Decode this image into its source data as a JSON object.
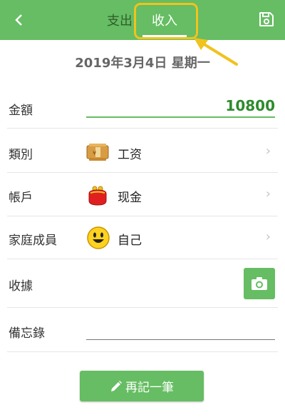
{
  "header": {
    "tab_expense": "支出",
    "tab_income": "收入",
    "active_tab": "收入",
    "accent": "#66bd63",
    "icons": {
      "back": "back-arrow-icon",
      "save": "save-icon"
    }
  },
  "date": "2019年3月4日 星期一",
  "form": {
    "amount": {
      "label": "金額",
      "value": "10800"
    },
    "category": {
      "label": "類別",
      "value": "工资",
      "icon": "money-icon"
    },
    "account": {
      "label": "帳戶",
      "value": "现金",
      "icon": "purse-icon"
    },
    "member": {
      "label": "家庭成員",
      "value": "自己",
      "icon": "smiley-icon"
    },
    "receipt": {
      "label": "收據",
      "icon": "camera-icon"
    },
    "memo": {
      "label": "備忘錄",
      "value": ""
    }
  },
  "actions": {
    "again_label": "再記一筆",
    "again_icon": "pencil-icon"
  },
  "highlight_color": "#f0c31d"
}
